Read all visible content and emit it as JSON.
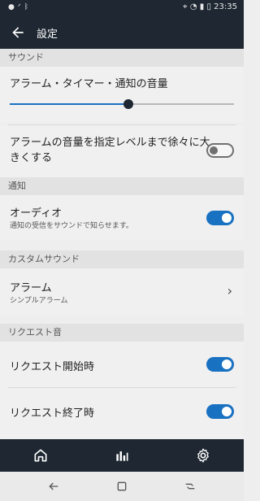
{
  "status_bar": {
    "left_icons": [
      "record-icon",
      "pulse-icon",
      "bluetooth-icon"
    ],
    "right_icons": [
      "location-icon",
      "bluetooth-icon",
      "nfc-icon",
      "mute-icon",
      "wifi-icon",
      "signal-icon",
      "battery-icon"
    ],
    "time": "23:35"
  },
  "app_bar": {
    "title": "設定"
  },
  "sections": {
    "sound": "サウンド",
    "notification": "通知",
    "custom_sound": "カスタムサウンド",
    "request_sound": "リクエスト音"
  },
  "alarm_volume": {
    "label": "アラーム・タイマー・通知の音量",
    "level": 0.53
  },
  "gradual": {
    "label_line1": "アラームの音量を指定レベルまで徐々に大",
    "label_line2": "きくする",
    "enabled": false
  },
  "audio": {
    "label": "オーディオ",
    "sub": "通知の受信をサウンドで知らせます。",
    "enabled": true
  },
  "alarm": {
    "label": "アラーム",
    "sub": "シンプルアラーム"
  },
  "request_start": {
    "label": "リクエスト開始時",
    "enabled": true
  },
  "request_end": {
    "label": "リクエスト終了時",
    "enabled": true
  },
  "colors": {
    "accent": "#1971c2",
    "bar": "#1e2732"
  }
}
